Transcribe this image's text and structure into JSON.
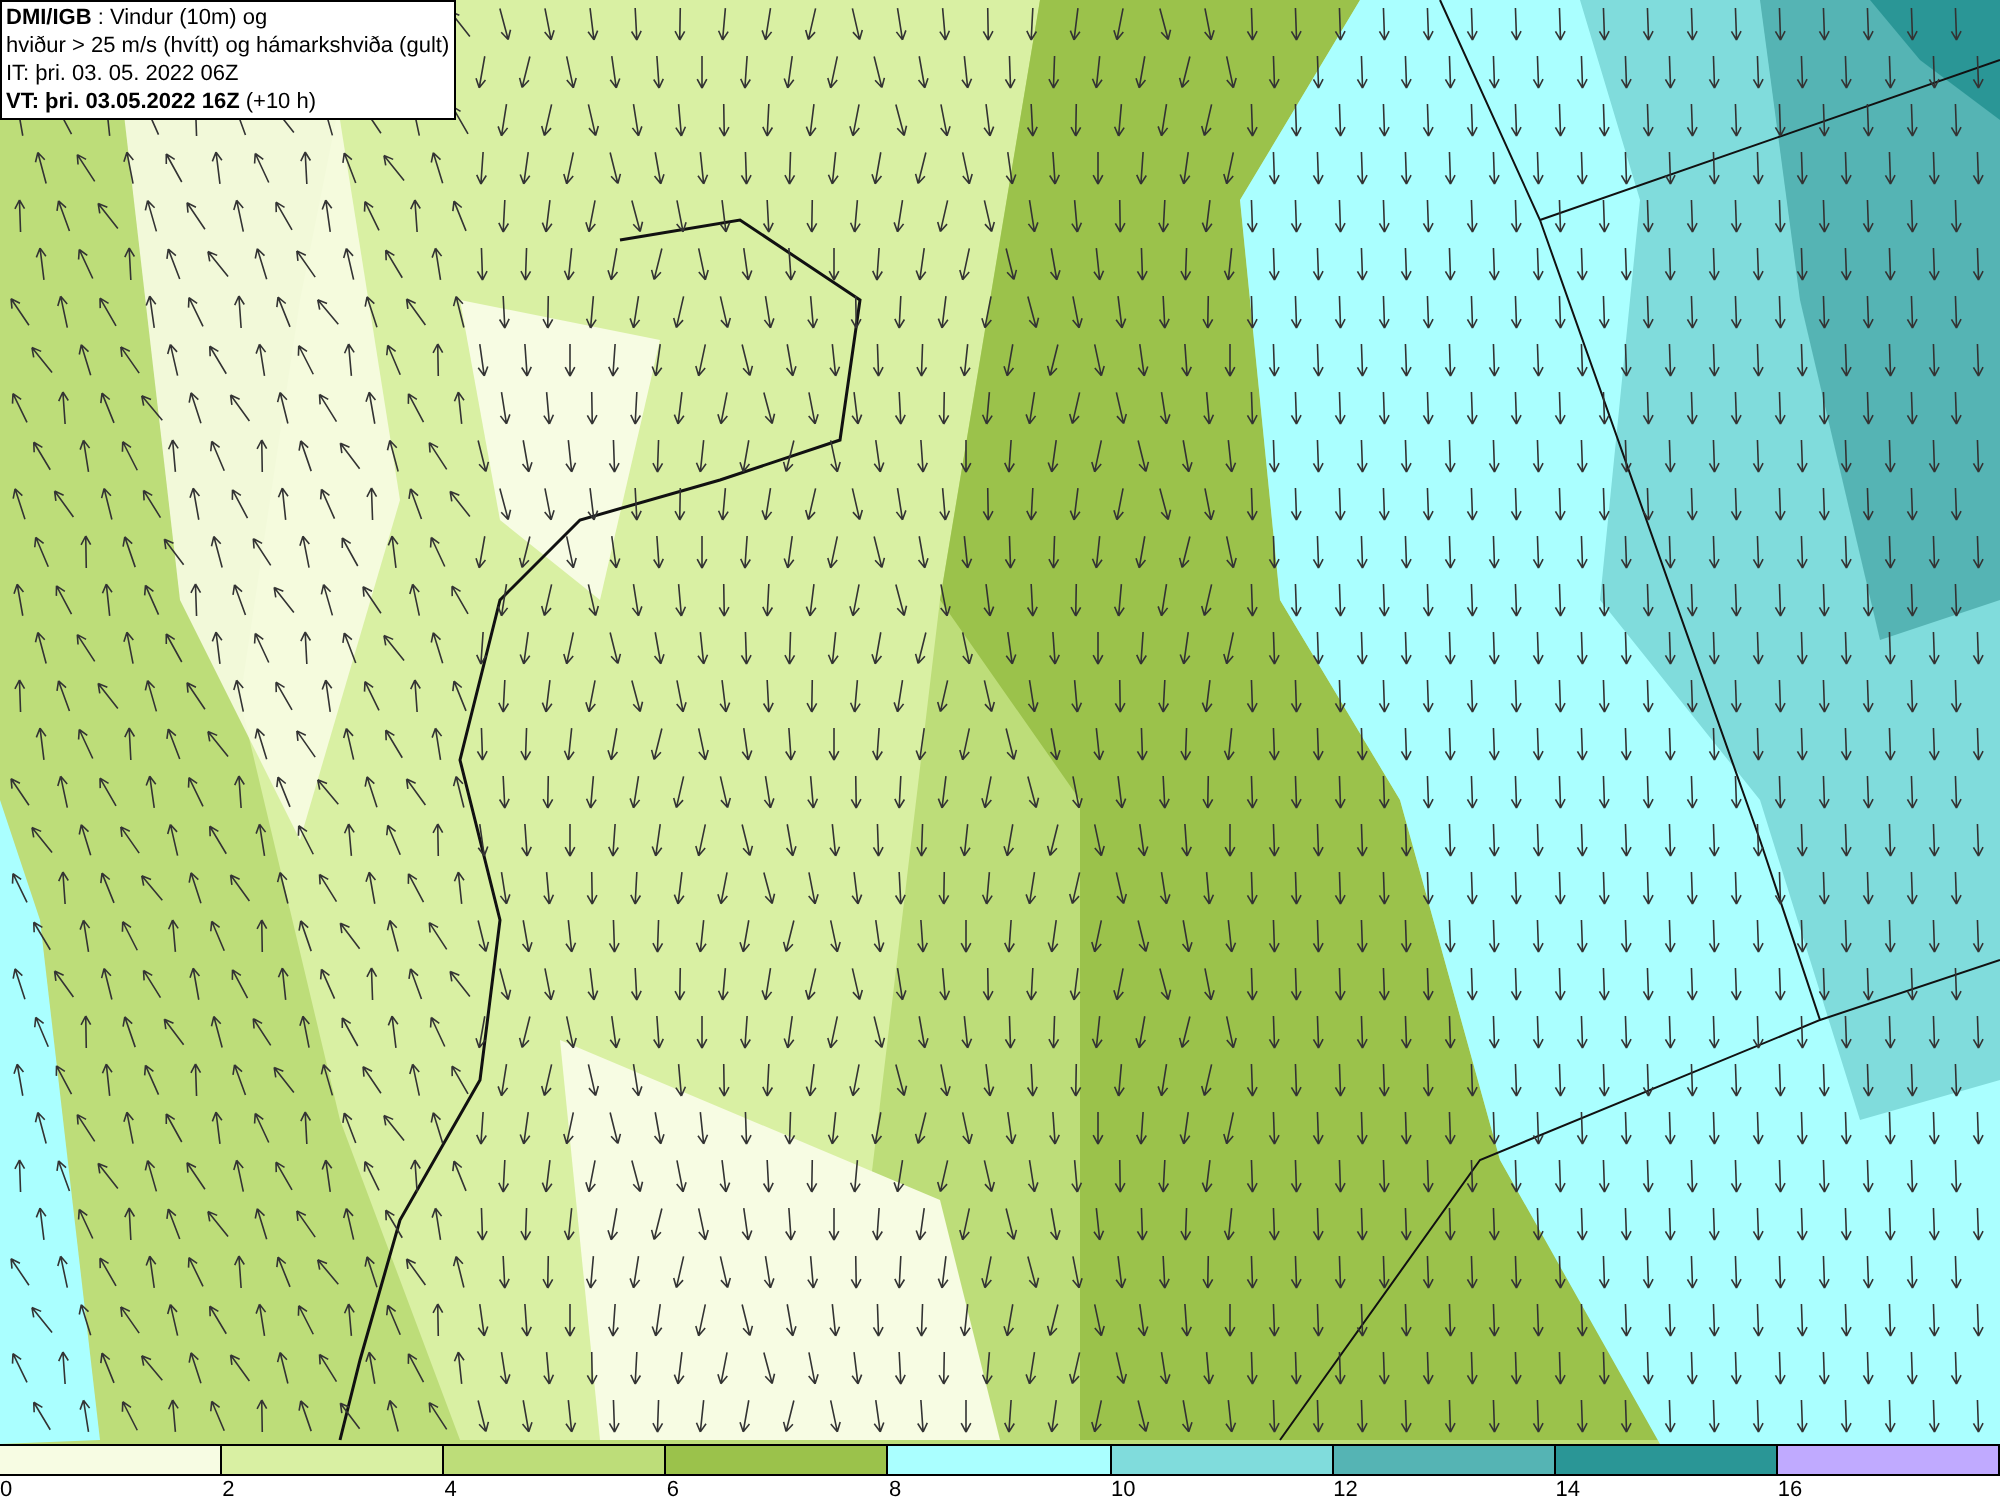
{
  "header": {
    "lines": [
      "**DMI/IGB** : Vindur (10m) og",
      "hviður > 25 m/s (hvítt) og hámarkshviða (gult)",
      "IT: þri. 03. 05. 2022 06Z",
      "**VT: þri. 03.05.2022 16Z** (+10 h)"
    ]
  },
  "legend": [
    {
      "label": "0",
      "color": "#f7fce3"
    },
    {
      "label": "2",
      "color": "#d9f0a3"
    },
    {
      "label": "4",
      "color": "#bddd79"
    },
    {
      "label": "6",
      "color": "#9bc24b"
    },
    {
      "label": "8",
      "color": "#aaffff"
    },
    {
      "label": "10",
      "color": "#80dcdc"
    },
    {
      "label": "12",
      "color": "#55b4b4"
    },
    {
      "label": "14",
      "color": "#2a9696"
    },
    {
      "label": "16",
      "color": "#c0aaff"
    }
  ]
}
